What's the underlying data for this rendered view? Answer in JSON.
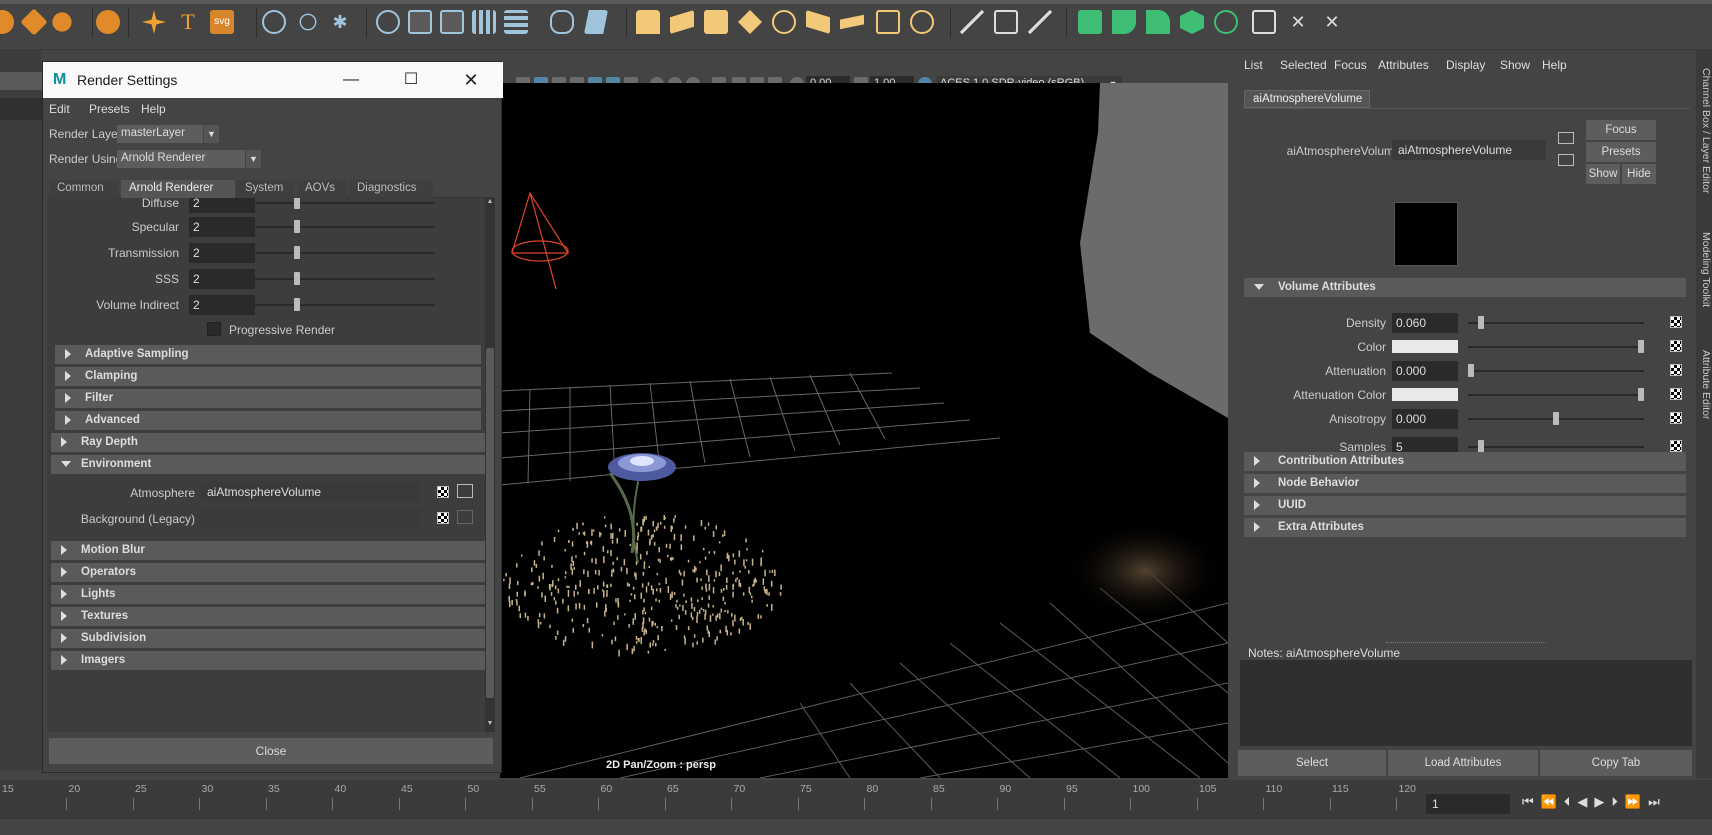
{
  "render_settings": {
    "title": "Render Settings",
    "menu": [
      "Edit",
      "Presets",
      "Help"
    ],
    "render_layer_label": "Render Layer",
    "render_layer_value": "masterLayer",
    "render_using_label": "Render Using",
    "render_using_value": "Arnold Renderer",
    "tabs": [
      "Common",
      "Arnold Renderer",
      "System",
      "AOVs",
      "Diagnostics"
    ],
    "ray_rows": [
      {
        "label": "Diffuse",
        "value": "2"
      },
      {
        "label": "Specular",
        "value": "2"
      },
      {
        "label": "Transmission",
        "value": "2"
      },
      {
        "label": "SSS",
        "value": "2"
      },
      {
        "label": "Volume Indirect",
        "value": "2"
      }
    ],
    "progressive_render": "Progressive Render",
    "sub_frames": [
      "Adaptive Sampling",
      "Clamping",
      "Filter",
      "Advanced"
    ],
    "ray_depth": "Ray Depth",
    "environment": "Environment",
    "atmosphere_label": "Atmosphere",
    "atmosphere_value": "aiAtmosphereVolume",
    "background_label": "Background (Legacy)",
    "frames": [
      "Motion Blur",
      "Operators",
      "Lights",
      "Textures",
      "Subdivision",
      "Imagers"
    ],
    "close": "Close"
  },
  "viewport": {
    "field_a": "0.00",
    "field_b": "1.00",
    "colorspace": "ACES 1.0 SDR-video (sRGB)",
    "hud": "2D Pan/Zoom : persp"
  },
  "attribute_editor": {
    "menu": [
      "List",
      "Selected",
      "Focus",
      "Attributes",
      "Display",
      "Show",
      "Help"
    ],
    "node_tab": "aiAtmosphereVolume",
    "node_label": "aiAtmosphereVolume:",
    "node_value": "aiAtmosphereVolume",
    "buttons": {
      "focus": "Focus",
      "presets": "Presets",
      "show": "Show",
      "hide": "Hide"
    },
    "volume_frame": "Volume Attributes",
    "rows": [
      {
        "label": "Density",
        "value": "0.060",
        "level": 0.06
      },
      {
        "label": "Color",
        "value": "",
        "level": 1.0
      },
      {
        "label": "Attenuation",
        "value": "0.000",
        "level": 0.0
      },
      {
        "label": "Attenuation Color",
        "value": "",
        "level": 1.0
      },
      {
        "label": "Anisotropy",
        "value": "0.000",
        "level": 0.5
      },
      {
        "label": "Samples",
        "value": "5",
        "level": 0.06
      }
    ],
    "frames": [
      "Contribution Attributes",
      "Node Behavior",
      "UUID",
      "Extra Attributes"
    ],
    "notes_label": "Notes:  aiAtmosphereVolume",
    "bottom_buttons": [
      "Select",
      "Load Attributes",
      "Copy Tab"
    ]
  },
  "side_tabs": [
    "Channel Box / Layer Editor",
    "Modeling Toolkit",
    "Attribute Editor"
  ],
  "timeline": {
    "ticks": [
      "15",
      "20",
      "25",
      "30",
      "35",
      "40",
      "45",
      "50",
      "55",
      "60",
      "65",
      "70",
      "75",
      "80",
      "85",
      "90",
      "95",
      "100",
      "105",
      "110",
      "115",
      "120"
    ],
    "current_frame": "1"
  },
  "colors": {
    "accent": "#5285a6",
    "panel": "#444444",
    "field": "#2a2a2a"
  }
}
